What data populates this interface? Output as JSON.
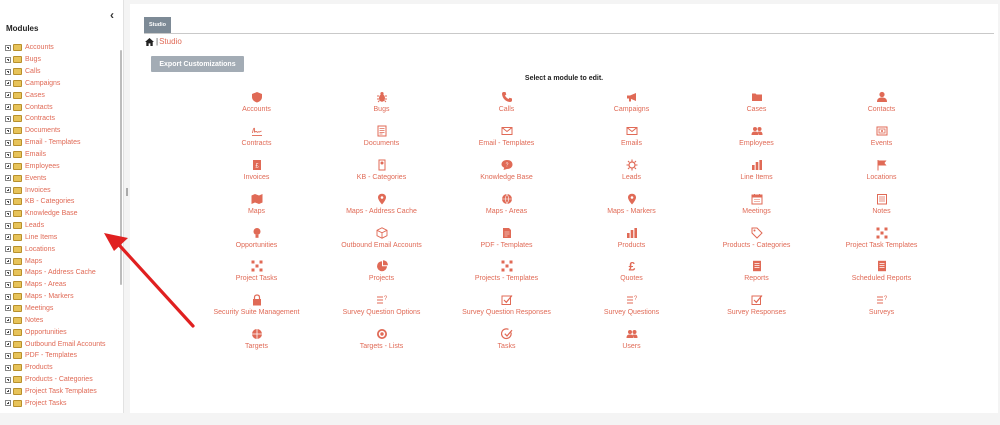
{
  "sidebar": {
    "title": "Modules",
    "collapse_glyph": "‹",
    "items": [
      "Accounts",
      "Bugs",
      "Calls",
      "Campaigns",
      "Cases",
      "Contacts",
      "Contracts",
      "Documents",
      "Email - Templates",
      "Emails",
      "Employees",
      "Events",
      "Invoices",
      "KB - Categories",
      "Knowledge Base",
      "Leads",
      "Line Items",
      "Locations",
      "Maps",
      "Maps - Address Cache",
      "Maps - Areas",
      "Maps - Markers",
      "Meetings",
      "Notes",
      "Opportunities",
      "Outbound Email Accounts",
      "PDF - Templates",
      "Products",
      "Products - Categories",
      "Project Task Templates",
      "Project Tasks"
    ]
  },
  "main": {
    "tab_label": "Studio",
    "breadcrumb_sep": "|",
    "breadcrumb_link": "Studio",
    "export_label": "Export Customizations",
    "select_message": "Select a module to edit.",
    "modules": [
      {
        "label": "Accounts",
        "icon": "shield-icon"
      },
      {
        "label": "Bugs",
        "icon": "bug-icon"
      },
      {
        "label": "Calls",
        "icon": "phone-icon"
      },
      {
        "label": "Campaigns",
        "icon": "megaphone-icon"
      },
      {
        "label": "Cases",
        "icon": "folder-icon"
      },
      {
        "label": "Contacts",
        "icon": "person-icon"
      },
      {
        "label": "Contracts",
        "icon": "signature-icon"
      },
      {
        "label": "Documents",
        "icon": "document-icon"
      },
      {
        "label": "Email - Templates",
        "icon": "envelope-icon"
      },
      {
        "label": "Emails",
        "icon": "envelope-icon"
      },
      {
        "label": "Employees",
        "icon": "people-icon"
      },
      {
        "label": "Events",
        "icon": "ticket-icon"
      },
      {
        "label": "Invoices",
        "icon": "invoice-icon"
      },
      {
        "label": "KB - Categories",
        "icon": "kb-icon"
      },
      {
        "label": "Knowledge Base",
        "icon": "speech-bubble-icon"
      },
      {
        "label": "Leads",
        "icon": "gear-icon"
      },
      {
        "label": "Line Items",
        "icon": "bar-chart-icon"
      },
      {
        "label": "Locations",
        "icon": "flag-icon"
      },
      {
        "label": "Maps",
        "icon": "map-icon"
      },
      {
        "label": "Maps - Address Cache",
        "icon": "map-pin-icon"
      },
      {
        "label": "Maps - Areas",
        "icon": "globe-icon"
      },
      {
        "label": "Maps - Markers",
        "icon": "map-pin-icon"
      },
      {
        "label": "Meetings",
        "icon": "calendar-icon"
      },
      {
        "label": "Notes",
        "icon": "notes-icon"
      },
      {
        "label": "Opportunities",
        "icon": "lightbulb-icon"
      },
      {
        "label": "Outbound Email Accounts",
        "icon": "cube-icon"
      },
      {
        "label": "PDF - Templates",
        "icon": "pdf-icon"
      },
      {
        "label": "Products",
        "icon": "bar-chart-icon"
      },
      {
        "label": "Products - Categories",
        "icon": "tag-icon"
      },
      {
        "label": "Project Task Templates",
        "icon": "network-icon"
      },
      {
        "label": "Project Tasks",
        "icon": "network-icon"
      },
      {
        "label": "Projects",
        "icon": "pie-chart-icon"
      },
      {
        "label": "Projects - Templates",
        "icon": "network-icon"
      },
      {
        "label": "Quotes",
        "icon": "pound-icon"
      },
      {
        "label": "Reports",
        "icon": "report-icon"
      },
      {
        "label": "Scheduled Reports",
        "icon": "report-icon"
      },
      {
        "label": "Security Suite Management",
        "icon": "lock-icon"
      },
      {
        "label": "Survey Question Options",
        "icon": "survey-list-icon"
      },
      {
        "label": "Survey Question Responses",
        "icon": "checkbox-icon"
      },
      {
        "label": "Survey Questions",
        "icon": "survey-list-icon"
      },
      {
        "label": "Survey Responses",
        "icon": "checkbox-icon"
      },
      {
        "label": "Surveys",
        "icon": "survey-list-icon"
      },
      {
        "label": "Targets",
        "icon": "crosshair-icon"
      },
      {
        "label": "Targets - Lists",
        "icon": "target-icon"
      },
      {
        "label": "Tasks",
        "icon": "task-check-icon"
      },
      {
        "label": "Users",
        "icon": "people-icon"
      }
    ]
  },
  "colors": {
    "accent": "#e06a56",
    "tab": "#7d8a96",
    "button": "#a3acb5",
    "arrow": "#e02020",
    "folder": "#e7c35a"
  }
}
